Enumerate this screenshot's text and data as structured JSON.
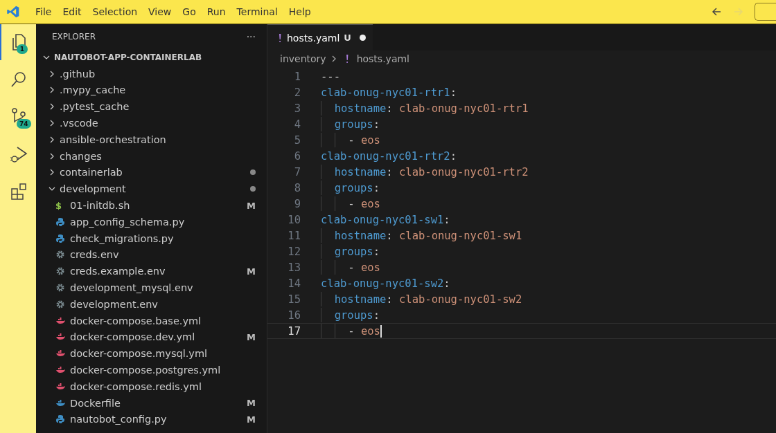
{
  "menu": [
    "File",
    "Edit",
    "Selection",
    "View",
    "Go",
    "Run",
    "Terminal",
    "Help"
  ],
  "nav": [
    {
      "kind": "back",
      "disabled": false
    },
    {
      "kind": "forward",
      "disabled": true
    }
  ],
  "activity_bar": [
    {
      "kind": "explorer",
      "selected": true,
      "badge": "1"
    },
    {
      "kind": "search",
      "selected": false
    },
    {
      "kind": "source-control",
      "selected": false,
      "badge": "74"
    },
    {
      "kind": "run-debug",
      "selected": false
    },
    {
      "kind": "extensions",
      "selected": false
    }
  ],
  "sidebar": {
    "title": "EXPLORER",
    "more": "···",
    "root": {
      "label": "NAUTOBOT-APP-CONTAINERLAB",
      "expanded": true,
      "children": [
        {
          "kind": "folder",
          "label": ".github",
          "expanded": false
        },
        {
          "kind": "folder",
          "label": ".mypy_cache",
          "expanded": false
        },
        {
          "kind": "folder",
          "label": ".pytest_cache",
          "expanded": false
        },
        {
          "kind": "folder",
          "label": ".vscode",
          "expanded": false
        },
        {
          "kind": "folder",
          "label": "ansible-orchestration",
          "expanded": false
        },
        {
          "kind": "folder",
          "label": "changes",
          "expanded": false
        },
        {
          "kind": "folder",
          "label": "containerlab",
          "expanded": false,
          "dot": true
        },
        {
          "kind": "folder",
          "label": "development",
          "expanded": true,
          "dot": true,
          "children": [
            {
              "kind": "shell",
              "icon": "$",
              "label": "01-initdb.sh",
              "status": "M"
            },
            {
              "kind": "python",
              "label": "app_config_schema.py"
            },
            {
              "kind": "python",
              "label": "check_migrations.py"
            },
            {
              "kind": "env",
              "label": "creds.env"
            },
            {
              "kind": "env",
              "label": "creds.example.env",
              "status": "M"
            },
            {
              "kind": "env",
              "label": "development_mysql.env"
            },
            {
              "kind": "env",
              "label": "development.env"
            },
            {
              "kind": "compose",
              "label": "docker-compose.base.yml"
            },
            {
              "kind": "compose",
              "label": "docker-compose.dev.yml",
              "status": "M"
            },
            {
              "kind": "compose",
              "label": "docker-compose.mysql.yml"
            },
            {
              "kind": "compose",
              "label": "docker-compose.postgres.yml"
            },
            {
              "kind": "compose",
              "label": "docker-compose.redis.yml"
            },
            {
              "kind": "docker",
              "label": "Dockerfile",
              "status": "M"
            },
            {
              "kind": "python",
              "label": "nautobot_config.py",
              "status": "M"
            }
          ]
        }
      ]
    }
  },
  "tabs": [
    {
      "label": "hosts.yaml",
      "status": "U",
      "modified": true,
      "selected": true
    }
  ],
  "breadcrumb": [
    {
      "label": "inventory",
      "kind": "folder"
    },
    {
      "label": "hosts.yaml",
      "kind": "yaml"
    }
  ],
  "editor": {
    "lines": [
      {
        "number": "1",
        "current": false,
        "tokens": [
          {
            "kind": "punct",
            "text": "---"
          }
        ]
      },
      {
        "number": "2",
        "current": false,
        "tokens": [
          {
            "kind": "key",
            "text": "clab-onug-nyc01-rtr1"
          },
          {
            "kind": "punct",
            "text": ":"
          }
        ]
      },
      {
        "number": "3",
        "current": false,
        "tokens": [
          {
            "kind": "guide"
          },
          {
            "kind": "key",
            "text": "hostname"
          },
          {
            "kind": "punct",
            "text": ": "
          },
          {
            "kind": "value",
            "text": "clab-onug-nyc01-rtr1"
          }
        ]
      },
      {
        "number": "4",
        "current": false,
        "tokens": [
          {
            "kind": "guide"
          },
          {
            "kind": "key",
            "text": "groups"
          },
          {
            "kind": "punct",
            "text": ":"
          }
        ]
      },
      {
        "number": "5",
        "current": false,
        "tokens": [
          {
            "kind": "guide"
          },
          {
            "kind": "guide"
          },
          {
            "kind": "punct",
            "text": "- "
          },
          {
            "kind": "value",
            "text": "eos"
          }
        ]
      },
      {
        "number": "6",
        "current": false,
        "tokens": [
          {
            "kind": "key",
            "text": "clab-onug-nyc01-rtr2"
          },
          {
            "kind": "punct",
            "text": ":"
          }
        ]
      },
      {
        "number": "7",
        "current": false,
        "tokens": [
          {
            "kind": "guide"
          },
          {
            "kind": "key",
            "text": "hostname"
          },
          {
            "kind": "punct",
            "text": ": "
          },
          {
            "kind": "value",
            "text": "clab-onug-nyc01-rtr2"
          }
        ]
      },
      {
        "number": "8",
        "current": false,
        "tokens": [
          {
            "kind": "guide"
          },
          {
            "kind": "key",
            "text": "groups"
          },
          {
            "kind": "punct",
            "text": ":"
          }
        ]
      },
      {
        "number": "9",
        "current": false,
        "tokens": [
          {
            "kind": "guide"
          },
          {
            "kind": "guide"
          },
          {
            "kind": "punct",
            "text": "- "
          },
          {
            "kind": "value",
            "text": "eos"
          }
        ]
      },
      {
        "number": "10",
        "current": false,
        "tokens": [
          {
            "kind": "key",
            "text": "clab-onug-nyc01-sw1"
          },
          {
            "kind": "punct",
            "text": ":"
          }
        ]
      },
      {
        "number": "11",
        "current": false,
        "tokens": [
          {
            "kind": "guide"
          },
          {
            "kind": "key",
            "text": "hostname"
          },
          {
            "kind": "punct",
            "text": ": "
          },
          {
            "kind": "value",
            "text": "clab-onug-nyc01-sw1"
          }
        ]
      },
      {
        "number": "12",
        "current": false,
        "tokens": [
          {
            "kind": "guide"
          },
          {
            "kind": "key",
            "text": "groups"
          },
          {
            "kind": "punct",
            "text": ":"
          }
        ]
      },
      {
        "number": "13",
        "current": false,
        "tokens": [
          {
            "kind": "guide"
          },
          {
            "kind": "guide"
          },
          {
            "kind": "punct",
            "text": "- "
          },
          {
            "kind": "value",
            "text": "eos"
          }
        ]
      },
      {
        "number": "14",
        "current": false,
        "tokens": [
          {
            "kind": "key",
            "text": "clab-onug-nyc01-sw2"
          },
          {
            "kind": "punct",
            "text": ":"
          }
        ]
      },
      {
        "number": "15",
        "current": false,
        "tokens": [
          {
            "kind": "guide"
          },
          {
            "kind": "key",
            "text": "hostname"
          },
          {
            "kind": "punct",
            "text": ": "
          },
          {
            "kind": "value",
            "text": "clab-onug-nyc01-sw2"
          }
        ]
      },
      {
        "number": "16",
        "current": false,
        "tokens": [
          {
            "kind": "guide"
          },
          {
            "kind": "key",
            "text": "groups"
          },
          {
            "kind": "punct",
            "text": ":"
          }
        ]
      },
      {
        "number": "17",
        "current": true,
        "tokens": [
          {
            "kind": "guide"
          },
          {
            "kind": "guide"
          },
          {
            "kind": "punct",
            "text": "- "
          },
          {
            "kind": "value",
            "text": "eos"
          }
        ]
      }
    ]
  }
}
